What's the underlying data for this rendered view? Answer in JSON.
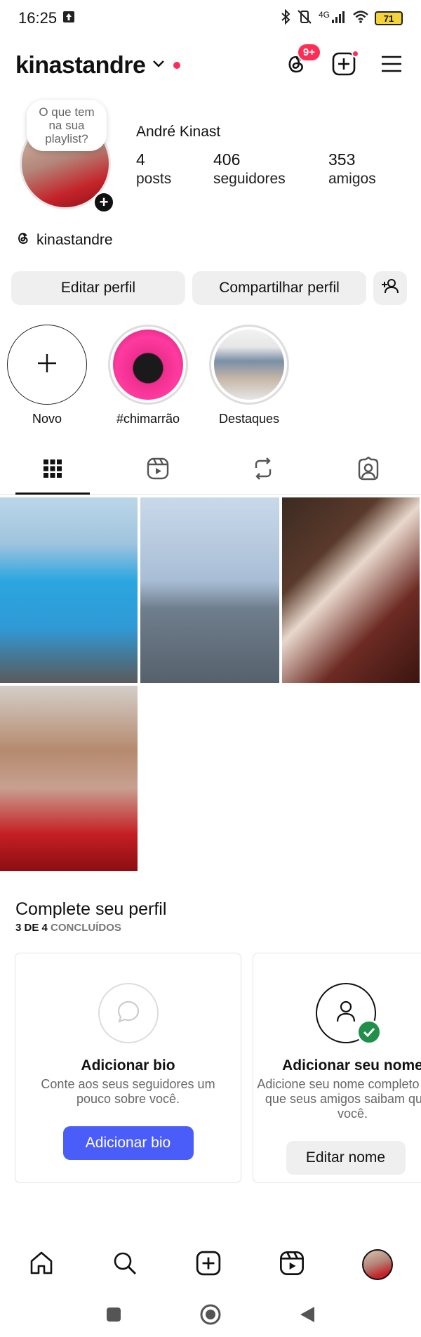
{
  "status_bar": {
    "time": "16:25",
    "network": "4G",
    "battery": "71"
  },
  "header": {
    "username": "kinastandre",
    "notifications_badge": "9+"
  },
  "profile": {
    "note": "O que tem na sua playlist?",
    "full_name": "André Kinast",
    "posts_count": "4",
    "posts_label": "posts",
    "followers_count": "406",
    "followers_label": "seguidores",
    "friends_count": "353",
    "friends_label": "amigos",
    "threads_handle": "kinastandre"
  },
  "buttons": {
    "edit_profile": "Editar perfil",
    "share_profile": "Compartilhar perfil"
  },
  "highlights": [
    {
      "label": "Novo"
    },
    {
      "label": "#chimarrão"
    },
    {
      "label": "Destaques"
    }
  ],
  "tabs": [
    "grid-icon",
    "reels-icon",
    "reposts-icon",
    "tagged-icon"
  ],
  "complete_profile": {
    "title": "Complete seu perfil",
    "progress_done": "3 DE 4",
    "progress_label": "CONCLUÍDOS",
    "cards": [
      {
        "title": "Adicionar bio",
        "description": "Conte aos seus seguidores um pouco sobre você.",
        "button": "Adicionar bio"
      },
      {
        "title": "Adicionar seu nome",
        "description": "Adicione seu nome completo para que seus amigos saibam que é você.",
        "button": "Editar nome"
      }
    ]
  },
  "colors": {
    "accent": "#4a5df9",
    "badge": "#ff2d55",
    "check": "#1f8f4a",
    "button_bg": "#efefef"
  }
}
